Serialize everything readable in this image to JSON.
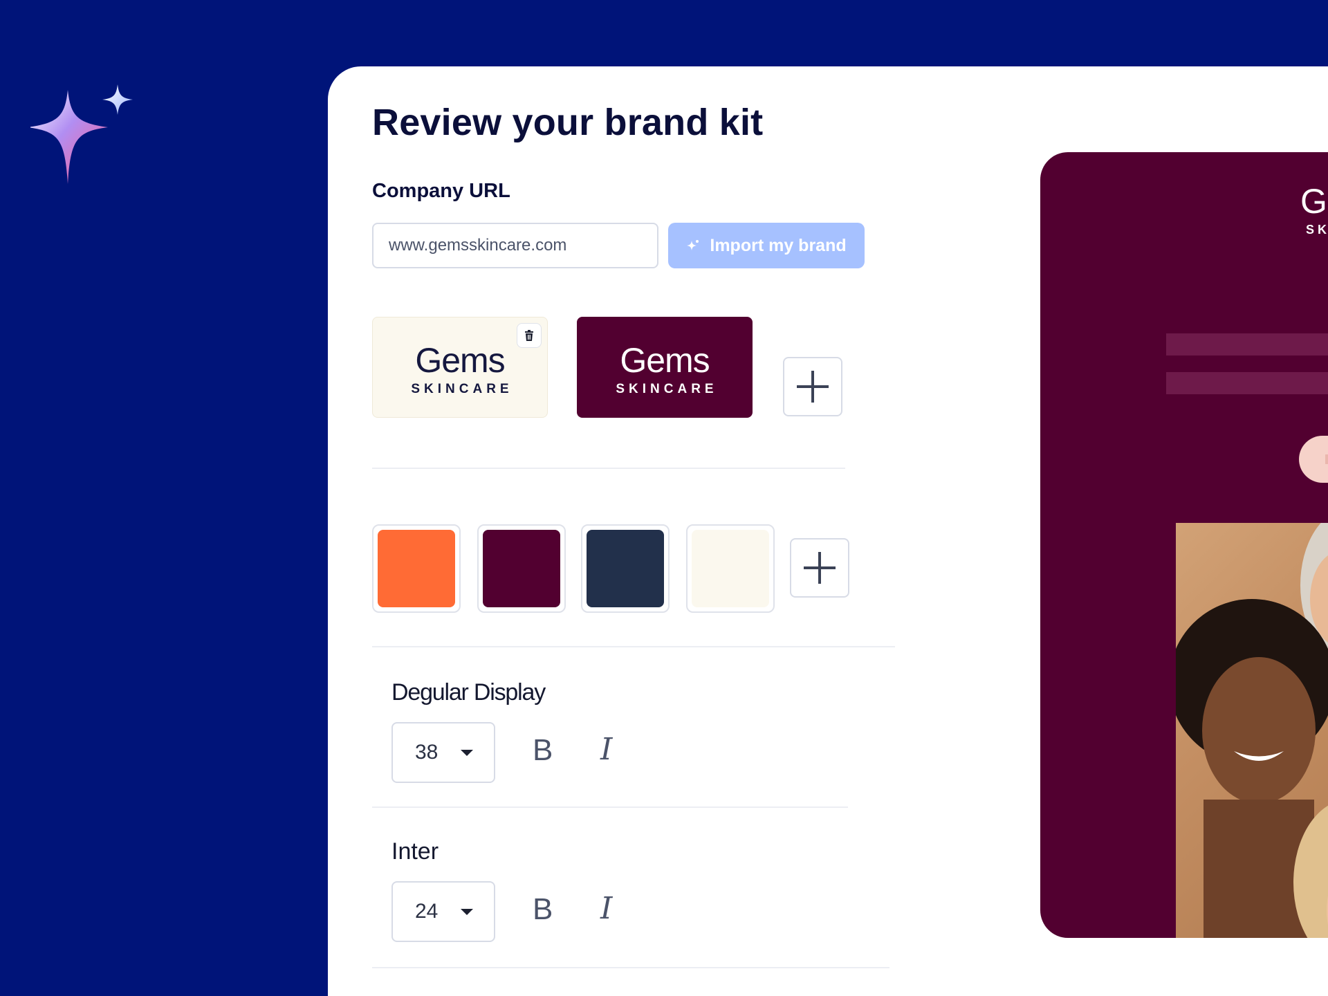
{
  "page": {
    "title": "Review your brand kit"
  },
  "company": {
    "label": "Company URL",
    "url_value": "www.gemsskincare.com",
    "import_button": "Import my brand"
  },
  "logos": [
    {
      "name": "Gems",
      "tagline": "SKINCARE",
      "variant": "light",
      "background": "#fbf8ee"
    },
    {
      "name": "Gems",
      "tagline": "SKINCARE",
      "variant": "dark",
      "background": "#520030"
    }
  ],
  "colors": [
    "#ff6b35",
    "#520030",
    "#22304b",
    "#fbf8ee"
  ],
  "fonts": [
    {
      "name": "Degular Display",
      "size": "38",
      "bold_label": "B",
      "italic_label": "I"
    },
    {
      "name": "Inter",
      "size": "24",
      "bold_label": "B",
      "italic_label": "I"
    }
  ],
  "preview": {
    "logo_name": "G",
    "logo_tag": "SK",
    "background": "#520030"
  },
  "theme": {
    "page_background": "#001479",
    "accent_button": "#a6c1ff"
  },
  "icons": {
    "brand_sparkle": "sparkle-icon",
    "import": "sparkle-small-icon",
    "delete": "trash-icon",
    "add": "plus-icon",
    "dropdown": "caret-down-icon"
  }
}
